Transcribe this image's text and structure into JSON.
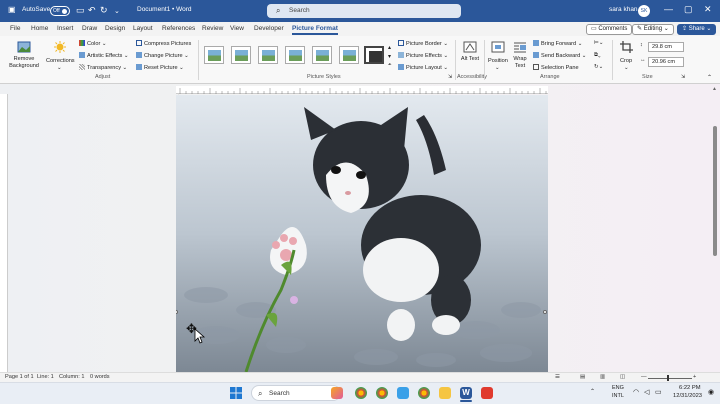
{
  "titlebar": {
    "autosave_label": "AutoSave",
    "autosave_state": "Off",
    "doc_title": "Document1 • Word",
    "search_placeholder": "Search",
    "user_name": "sara khan",
    "user_initials": "SK"
  },
  "tabs": [
    "File",
    "Home",
    "Insert",
    "Draw",
    "Design",
    "Layout",
    "References",
    "Review",
    "View",
    "Developer",
    "Picture Format"
  ],
  "active_tab": "Picture Format",
  "tab_buttons": {
    "comments": "Comments",
    "editing": "Editing",
    "share": "Share"
  },
  "ribbon": {
    "remove_background": "Remove Background",
    "corrections": "Corrections",
    "color": "Color",
    "artistic_effects": "Artistic Effects",
    "transparency": "Transparency",
    "compress_pictures": "Compress Pictures",
    "change_picture": "Change Picture",
    "reset_picture": "Reset Picture",
    "adjust_label": "Adjust",
    "picture_styles_label": "Picture Styles",
    "picture_border": "Picture Border",
    "picture_effects": "Picture Effects",
    "picture_layout": "Picture Layout",
    "alt_text": "Alt Text",
    "accessibility_label": "Accessibility",
    "position": "Position",
    "wrap_text": "Wrap Text",
    "bring_forward": "Bring Forward",
    "send_backward": "Send Backward",
    "selection_pane": "Selection Pane",
    "arrange_label": "Arrange",
    "crop": "Crop",
    "height_value": "29.8 cm",
    "width_value": "20.96 cm",
    "size_label": "Size"
  },
  "statusbar": {
    "page": "Page 1 of 1",
    "line": "Line: 1",
    "column": "Column: 1",
    "words": "0 words"
  },
  "taskbar": {
    "search": "Search",
    "lang_top": "ENG",
    "lang_bottom": "INTL",
    "time": "6:22 PM",
    "date": "12/31/2023"
  },
  "colors": {
    "word_blue": "#2b579a",
    "ribbon_bg": "#f8f8f8"
  }
}
